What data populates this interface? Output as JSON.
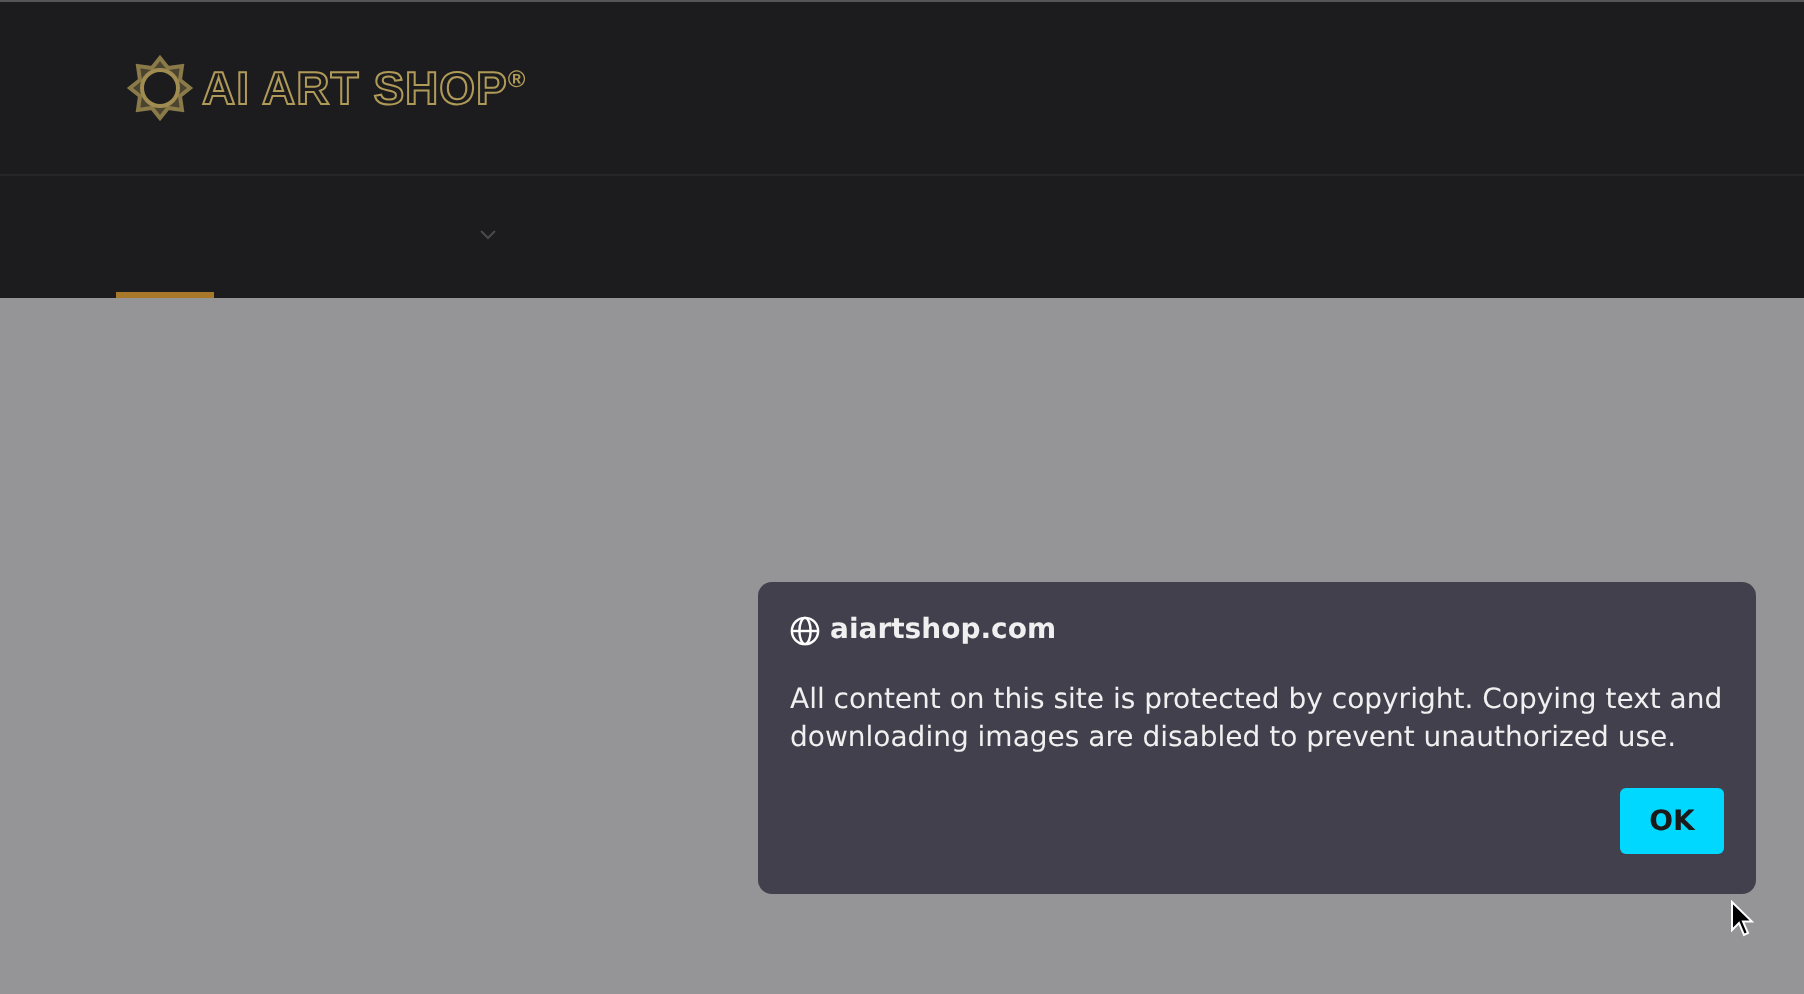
{
  "header": {
    "logo_text": "AI ART SHOP$^{®}$"
  },
  "dialog": {
    "site": "aiartshop.com",
    "message": "All content on this site is protected by copyright. Copying text and downloading images are disabled to prevent unauthorized use.",
    "button": "OK"
  }
}
